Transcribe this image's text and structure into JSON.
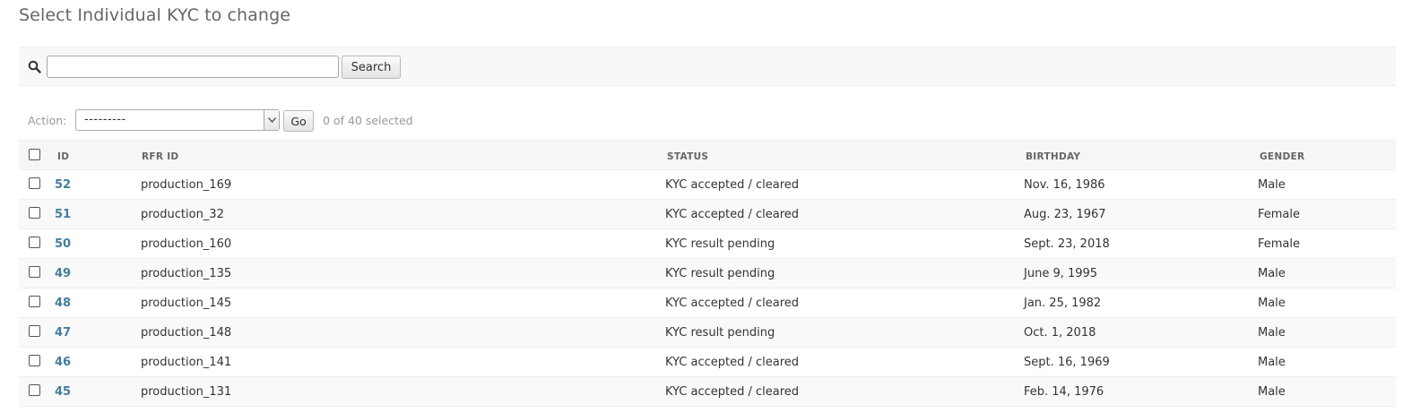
{
  "page": {
    "title": "Select Individual KYC to change"
  },
  "search": {
    "value": "",
    "placeholder": "",
    "button_label": "Search"
  },
  "actions": {
    "label": "Action:",
    "selected": "---------",
    "go_label": "Go",
    "selection_count": "0 of 40 selected"
  },
  "table": {
    "columns": [
      "ID",
      "RFR ID",
      "STATUS",
      "BIRTHDAY",
      "GENDER"
    ],
    "rows": [
      {
        "id": "52",
        "rfr_id": "production_169",
        "status": "KYC accepted / cleared",
        "birthday": "Nov. 16, 1986",
        "gender": "Male"
      },
      {
        "id": "51",
        "rfr_id": "production_32",
        "status": "KYC accepted / cleared",
        "birthday": "Aug. 23, 1967",
        "gender": "Female"
      },
      {
        "id": "50",
        "rfr_id": "production_160",
        "status": "KYC result pending",
        "birthday": "Sept. 23, 2018",
        "gender": "Female"
      },
      {
        "id": "49",
        "rfr_id": "production_135",
        "status": "KYC result pending",
        "birthday": "June 9, 1995",
        "gender": "Male"
      },
      {
        "id": "48",
        "rfr_id": "production_145",
        "status": "KYC accepted / cleared",
        "birthday": "Jan. 25, 1982",
        "gender": "Male"
      },
      {
        "id": "47",
        "rfr_id": "production_148",
        "status": "KYC result pending",
        "birthday": "Oct. 1, 2018",
        "gender": "Male"
      },
      {
        "id": "46",
        "rfr_id": "production_141",
        "status": "KYC accepted / cleared",
        "birthday": "Sept. 16, 1969",
        "gender": "Male"
      },
      {
        "id": "45",
        "rfr_id": "production_131",
        "status": "KYC accepted / cleared",
        "birthday": "Feb. 14, 1976",
        "gender": "Male"
      }
    ]
  },
  "icons": {
    "search": "search-icon",
    "dropdown": "chevron-down-icon"
  },
  "colors": {
    "link": "#447e9b",
    "muted": "#999999",
    "header_bg": "#f6f6f6"
  }
}
